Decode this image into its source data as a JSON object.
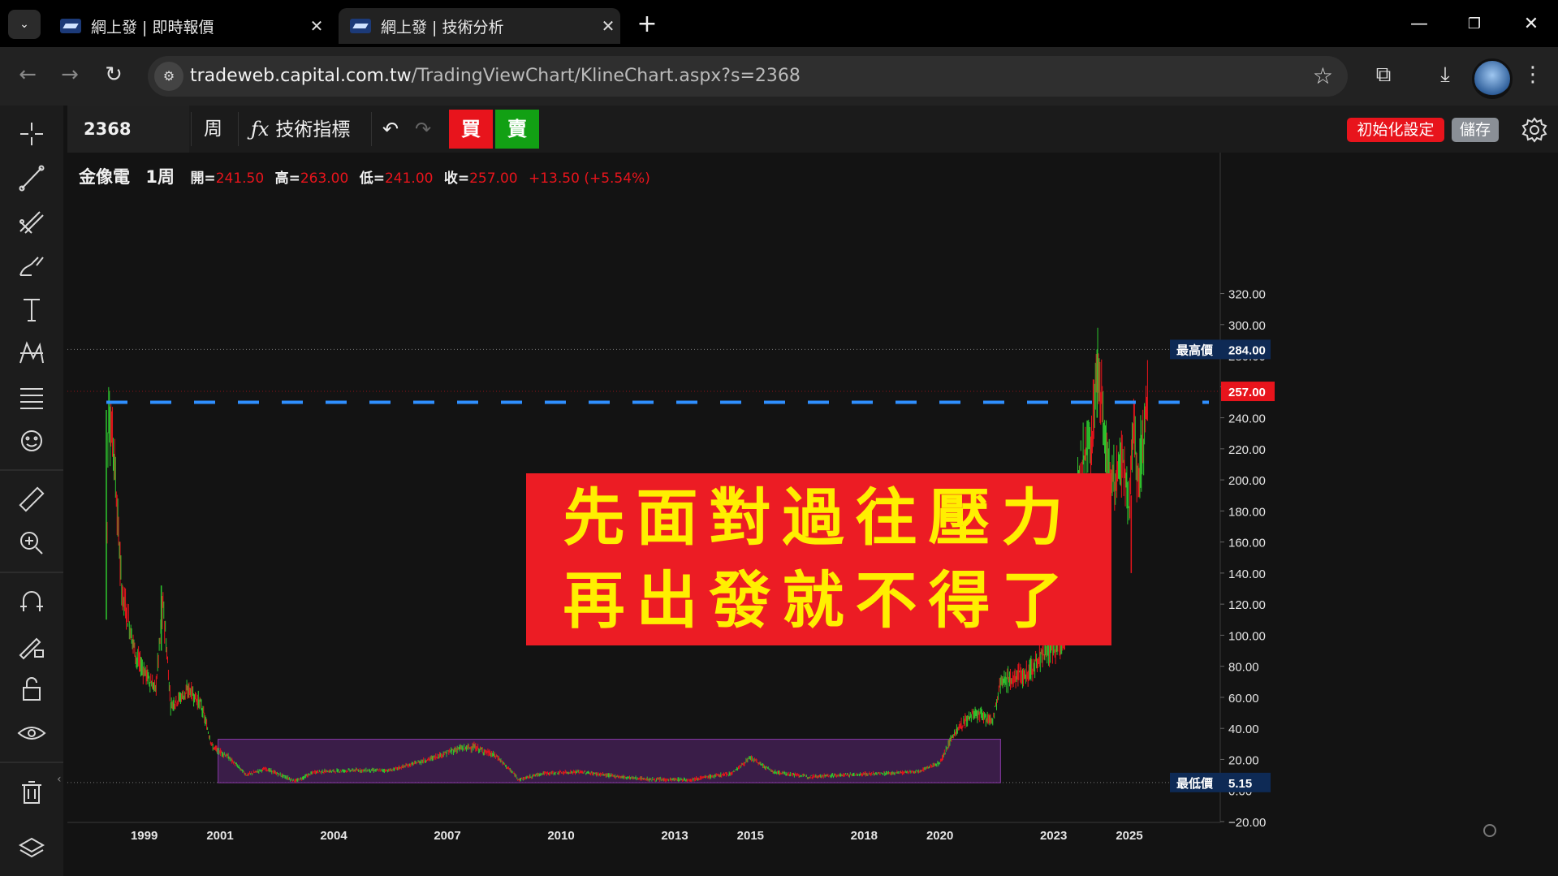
{
  "browser": {
    "tabs": [
      {
        "title": "網上發 | 即時報價",
        "active": false
      },
      {
        "title": "網上發 | 技術分析",
        "active": true
      }
    ],
    "url_host": "tradeweb.capital.com.tw",
    "url_path": "/TradingViewChart/KlineChart.aspx?s=2368"
  },
  "toolbar": {
    "symbol": "2368",
    "period": "周",
    "indicators_label": "技術指標",
    "buy_label": "買",
    "sell_label": "賣",
    "reset_label": "初始化設定",
    "save_label": "儲存"
  },
  "legend": {
    "name": "金像電",
    "period": "1周",
    "open_label": "開=",
    "open": "241.50",
    "high_label": "高=",
    "high": "263.00",
    "low_label": "低=",
    "low": "241.00",
    "close_label": "收=",
    "close": "257.00",
    "change": "+13.50 (+5.54%)"
  },
  "banner": {
    "line1": "先面對過往壓力",
    "line2": "再出發就不得了"
  },
  "colors": {
    "up": "#e8141c",
    "down": "#2ec72e",
    "resistance": "#2f8fff",
    "box": "#6a2a8a",
    "banner_bg": "#ec1c24",
    "banner_text": "#ffef00"
  },
  "chart_data": {
    "type": "candlestick",
    "title": "",
    "y_ticks": [
      "320.00",
      "300.00",
      "280.00",
      "260.00",
      "240.00",
      "220.00",
      "200.00",
      "180.00",
      "160.00",
      "140.00",
      "120.00",
      "100.00",
      "80.00",
      "60.00",
      "40.00",
      "20.00",
      "0.00",
      "−20.00"
    ],
    "ylim": [
      -20,
      330
    ],
    "x_ticks": [
      "1999",
      "2001",
      "2004",
      "2007",
      "2010",
      "2013",
      "2015",
      "2018",
      "2020",
      "2023",
      "2025"
    ],
    "x_tick_years": [
      1999,
      2001,
      2004,
      2007,
      2010,
      2013,
      2015,
      2018,
      2020,
      2023,
      2025
    ],
    "xlim": [
      1997.1,
      2027.4
    ],
    "last_price": "257.00",
    "last_value": 257,
    "high_marker": {
      "label": "最高價",
      "value": "284.00",
      "price": 284
    },
    "low_marker": {
      "label": "最低價",
      "value": "5.15",
      "price": 5.15
    },
    "resistance_level": 250,
    "price_path": [
      {
        "year": 1998.0,
        "price": 120
      },
      {
        "year": 1998.05,
        "price": 248
      },
      {
        "year": 1998.2,
        "price": 220
      },
      {
        "year": 1998.4,
        "price": 130
      },
      {
        "year": 1998.8,
        "price": 85
      },
      {
        "year": 1999.3,
        "price": 65
      },
      {
        "year": 1999.5,
        "price": 120
      },
      {
        "year": 1999.7,
        "price": 55
      },
      {
        "year": 2000.2,
        "price": 65
      },
      {
        "year": 2000.5,
        "price": 55
      },
      {
        "year": 2000.8,
        "price": 28
      },
      {
        "year": 2001.2,
        "price": 22
      },
      {
        "year": 2001.7,
        "price": 10
      },
      {
        "year": 2002.2,
        "price": 14
      },
      {
        "year": 2003.0,
        "price": 6
      },
      {
        "year": 2003.5,
        "price": 12
      },
      {
        "year": 2004.5,
        "price": 13
      },
      {
        "year": 2005.5,
        "price": 13
      },
      {
        "year": 2006.5,
        "price": 20
      },
      {
        "year": 2007.3,
        "price": 27
      },
      {
        "year": 2007.7,
        "price": 28
      },
      {
        "year": 2008.3,
        "price": 22
      },
      {
        "year": 2008.9,
        "price": 7
      },
      {
        "year": 2009.5,
        "price": 11
      },
      {
        "year": 2010.5,
        "price": 12
      },
      {
        "year": 2011.5,
        "price": 9
      },
      {
        "year": 2012.4,
        "price": 7
      },
      {
        "year": 2013.4,
        "price": 7
      },
      {
        "year": 2014.5,
        "price": 11
      },
      {
        "year": 2015.0,
        "price": 21
      },
      {
        "year": 2015.6,
        "price": 12
      },
      {
        "year": 2016.5,
        "price": 9
      },
      {
        "year": 2017.5,
        "price": 10
      },
      {
        "year": 2018.5,
        "price": 11
      },
      {
        "year": 2019.4,
        "price": 12
      },
      {
        "year": 2020.0,
        "price": 18
      },
      {
        "year": 2020.4,
        "price": 38
      },
      {
        "year": 2020.9,
        "price": 50
      },
      {
        "year": 2021.4,
        "price": 45
      },
      {
        "year": 2021.6,
        "price": 70
      },
      {
        "year": 2022.3,
        "price": 75
      },
      {
        "year": 2022.7,
        "price": 88
      },
      {
        "year": 2023.0,
        "price": 90
      },
      {
        "year": 2023.3,
        "price": 98
      },
      {
        "year": 2023.4,
        "price": 125
      },
      {
        "year": 2023.55,
        "price": 170
      },
      {
        "year": 2023.7,
        "price": 210
      },
      {
        "year": 2024.0,
        "price": 225
      },
      {
        "year": 2024.15,
        "price": 275
      },
      {
        "year": 2024.3,
        "price": 240
      },
      {
        "year": 2024.5,
        "price": 200
      },
      {
        "year": 2024.8,
        "price": 210
      },
      {
        "year": 2025.0,
        "price": 180
      },
      {
        "year": 2025.1,
        "price": 240
      },
      {
        "year": 2025.2,
        "price": 200
      },
      {
        "year": 2025.35,
        "price": 225
      },
      {
        "year": 2025.5,
        "price": 257
      }
    ]
  }
}
